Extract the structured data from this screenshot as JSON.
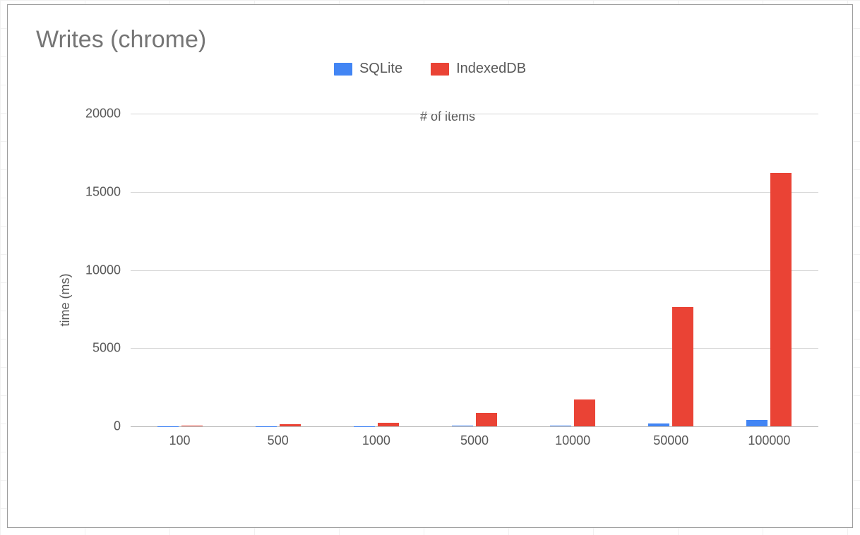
{
  "title": "Writes (chrome)",
  "legend": [
    {
      "name": "SQLite",
      "color": "#4285f4"
    },
    {
      "name": "IndexedDB",
      "color": "#ea4335"
    }
  ],
  "axes": {
    "xlabel": "# of items",
    "ylabel": "time (ms)",
    "ylim": [
      0,
      20000
    ],
    "yticks": [
      0,
      5000,
      10000,
      15000,
      20000
    ]
  },
  "chart_data": {
    "type": "bar",
    "title": "Writes (chrome)",
    "xlabel": "# of items",
    "ylabel": "time (ms)",
    "ylim": [
      0,
      20000
    ],
    "categories": [
      "100",
      "500",
      "1000",
      "5000",
      "10000",
      "50000",
      "100000"
    ],
    "series": [
      {
        "name": "SQLite",
        "color": "#4285f4",
        "values": [
          5,
          10,
          20,
          40,
          60,
          200,
          420
        ]
      },
      {
        "name": "IndexedDB",
        "color": "#ea4335",
        "values": [
          30,
          120,
          220,
          850,
          1700,
          7650,
          16200
        ]
      }
    ],
    "legend_position": "top",
    "grid": true
  }
}
